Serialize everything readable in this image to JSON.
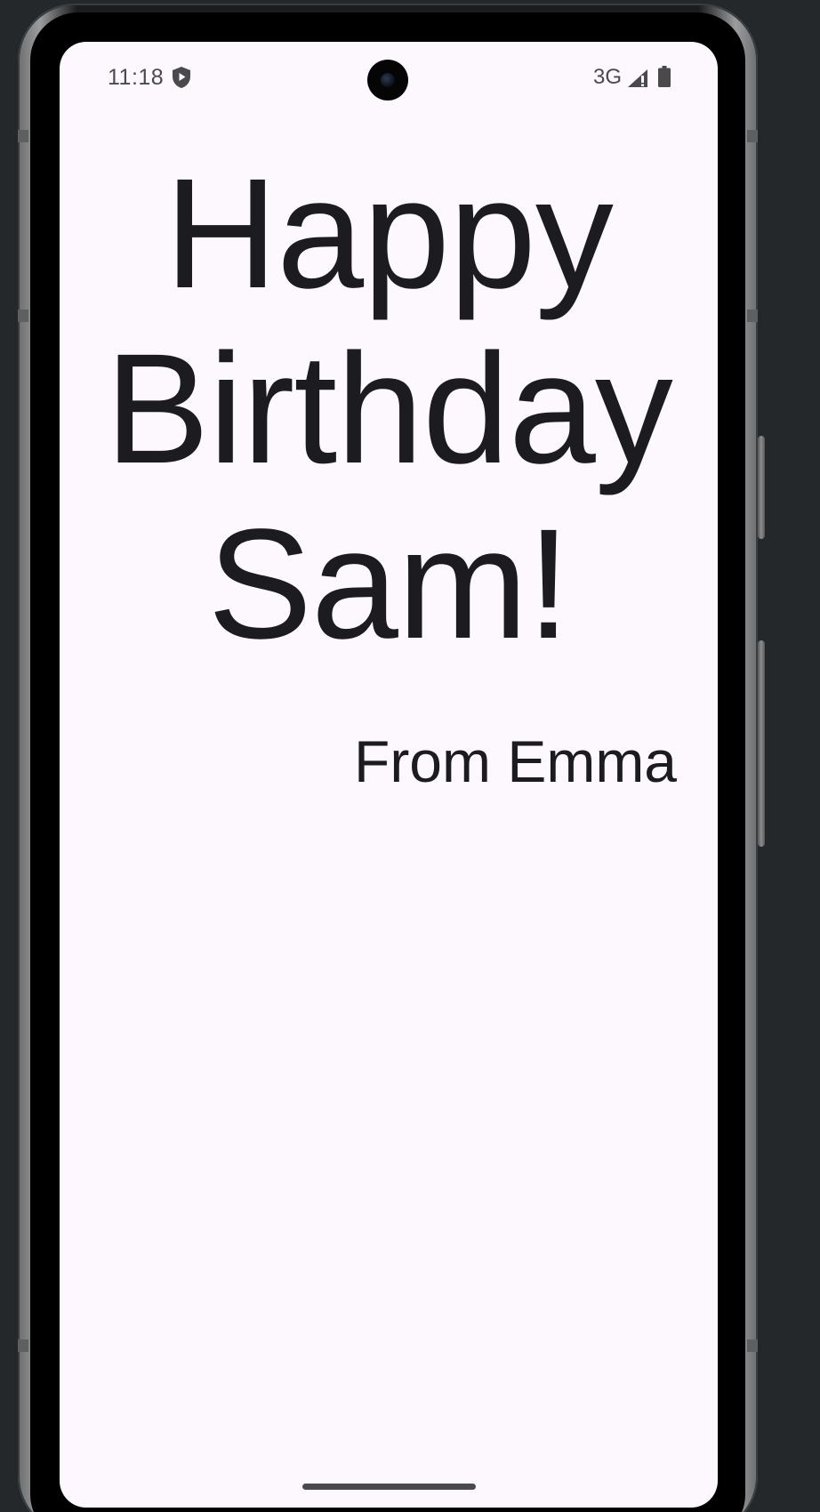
{
  "status_bar": {
    "time": "11:18",
    "network": "3G",
    "icons": [
      "shield-play-icon",
      "signal-icon",
      "battery-icon"
    ]
  },
  "greeting": {
    "message": "Happy Birthday Sam!",
    "signature": "From Emma"
  },
  "colors": {
    "screen_background": "#fdf8fd",
    "text": "#1c1b1f",
    "status_icons": "#4a4a4d",
    "device_background": "#25282b"
  }
}
